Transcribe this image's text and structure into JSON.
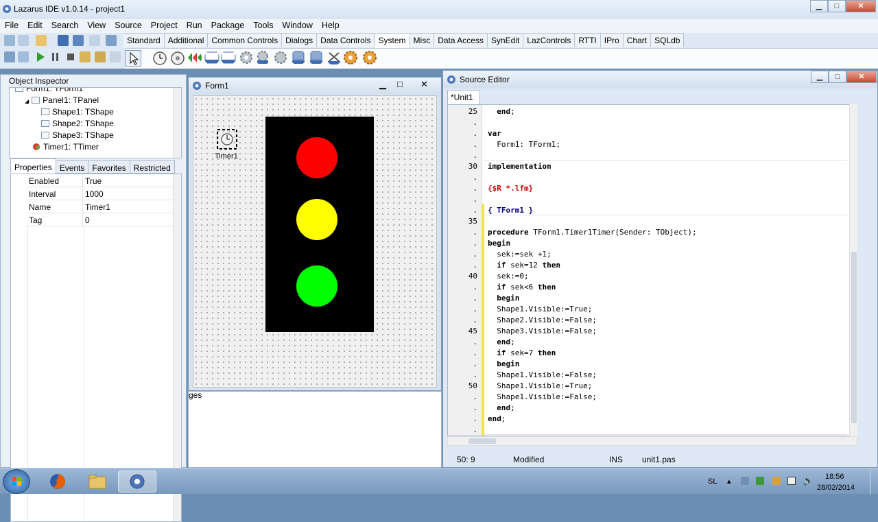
{
  "app": {
    "title": "Lazarus IDE v1.0.14 - project1",
    "minimize": "▁",
    "maximize": "□",
    "close": "✕"
  },
  "menu": [
    "File",
    "Edit",
    "Search",
    "View",
    "Source",
    "Project",
    "Run",
    "Package",
    "Tools",
    "Window",
    "Help"
  ],
  "palette_tabs": [
    "Standard",
    "Additional",
    "Common Controls",
    "Dialogs",
    "Data Controls",
    "System",
    "Misc",
    "Data Access",
    "SynEdit",
    "LazControls",
    "RTTI",
    "IPro",
    "Chart",
    "SQLdb"
  ],
  "active_palette_tab": "System",
  "object_inspector": {
    "title": "Object Inspector",
    "tree": [
      {
        "label": "Form1: TForm1",
        "level": 0
      },
      {
        "label": "Panel1: TPanel",
        "level": 1
      },
      {
        "label": "Shape1: TShape",
        "level": 2
      },
      {
        "label": "Shape2: TShape",
        "level": 2
      },
      {
        "label": "Shape3: TShape",
        "level": 2
      },
      {
        "label": "Timer1: TTimer",
        "level": 1
      }
    ],
    "tabs": [
      "Properties",
      "Events",
      "Favorites",
      "Restricted"
    ],
    "properties": [
      {
        "name": "Enabled",
        "value": "True"
      },
      {
        "name": "Interval",
        "value": "1000"
      },
      {
        "name": "Name",
        "value": "Timer1"
      },
      {
        "name": "Tag",
        "value": "0"
      }
    ]
  },
  "form_designer": {
    "title": "Form1",
    "timer_label": "Timer1",
    "lights": [
      "#ff0000",
      "#ffff00",
      "#00ff00"
    ],
    "messages_label": "ges"
  },
  "source_editor": {
    "title": "Source Editor",
    "tab": "*Unit1",
    "line_numbers": [
      "25",
      ".",
      ".",
      ".",
      ".",
      "30",
      ".",
      ".",
      ".",
      ".",
      "35",
      ".",
      ".",
      ".",
      ".",
      "40",
      ".",
      ".",
      ".",
      ".",
      "45",
      ".",
      ".",
      ".",
      ".",
      "50",
      ".",
      ".",
      ".",
      "."
    ],
    "status": {
      "position": "50: 9",
      "modified": "Modified",
      "mode": "INS",
      "file": "unit1.pas"
    }
  },
  "taskbar": {
    "lang": "SL",
    "time": "18:56",
    "date": "28/02/2014"
  }
}
